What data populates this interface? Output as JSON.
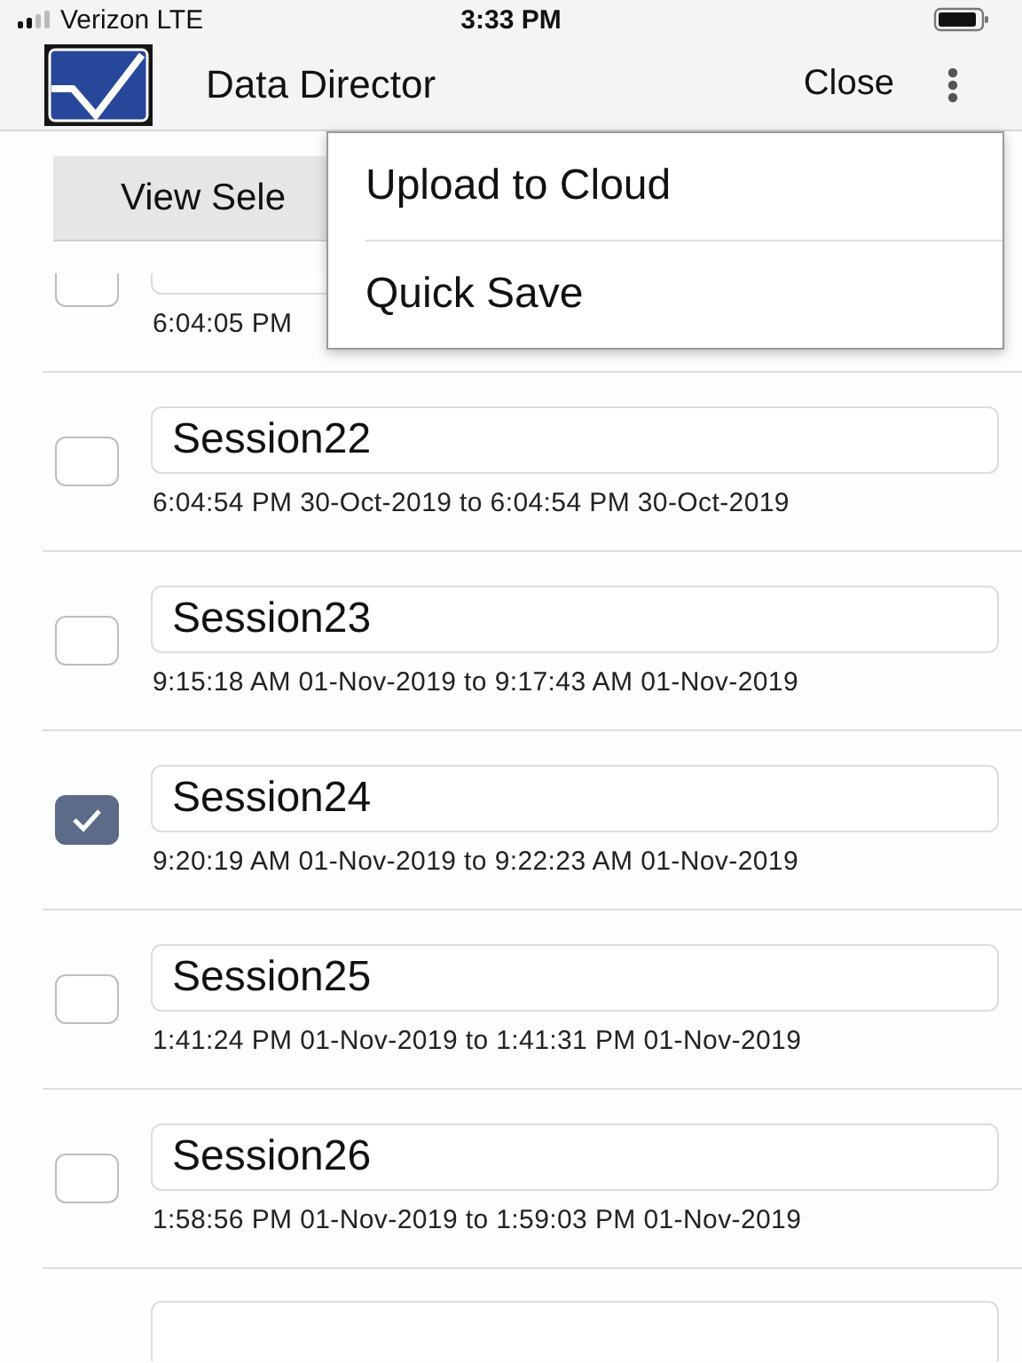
{
  "status_bar": {
    "carrier": "Verizon LTE",
    "time": "3:33 PM"
  },
  "header": {
    "title": "Data Director",
    "close": "Close"
  },
  "view_button": {
    "label": "View Sele"
  },
  "menu": {
    "items": [
      {
        "label": "Upload to Cloud"
      },
      {
        "label": "Quick Save"
      }
    ]
  },
  "sessions": [
    {
      "kind": "partial_top",
      "checked": false,
      "date": "6:04:05 PM"
    },
    {
      "kind": "full",
      "checked": false,
      "name": "Session22",
      "date": "6:04:54 PM 30-Oct-2019 to 6:04:54 PM 30-Oct-2019"
    },
    {
      "kind": "full",
      "checked": false,
      "name": "Session23",
      "date": "9:15:18 AM 01-Nov-2019 to 9:17:43 AM 01-Nov-2019"
    },
    {
      "kind": "full",
      "checked": true,
      "name": "Session24",
      "date": "9:20:19 AM 01-Nov-2019 to 9:22:23 AM 01-Nov-2019"
    },
    {
      "kind": "full",
      "checked": false,
      "name": "Session25",
      "date": "1:41:24 PM 01-Nov-2019 to 1:41:31 PM 01-Nov-2019"
    },
    {
      "kind": "full",
      "checked": false,
      "name": "Session26",
      "date": "1:58:56 PM 01-Nov-2019 to 1:59:03 PM 01-Nov-2019"
    },
    {
      "kind": "partial_bottom"
    }
  ]
}
